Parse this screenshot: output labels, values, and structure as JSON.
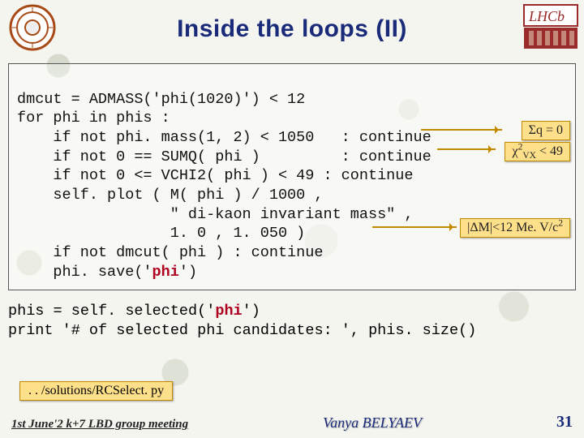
{
  "header": {
    "title": "Inside the loops (II)"
  },
  "code": {
    "l1": "dmcut = ADMASS('phi(1020)') < 12",
    "l2": "for phi in phis :",
    "l3": "    if not phi. mass(1, 2) < 1050   : continue",
    "l4": "    if not 0 == SUMQ( phi )         : continue",
    "l5": "    if not 0 <= VCHI2( phi ) < 49 : continue",
    "l6": "    self. plot ( M( phi ) / 1000 ,",
    "l7": "                 \" di-kaon invariant mass\" ,",
    "l8": "                 1. 0 , 1. 050 )",
    "l9": "    if not dmcut( phi ) : continue",
    "l10a": "    phi. save('",
    "l10b": "phi",
    "l10c": "')"
  },
  "callouts": {
    "c1": "Σq = 0",
    "c3_a": "|ΔM|<12 Me. V/c",
    "c3_sup": "2"
  },
  "lower": {
    "l1a": "phis = self. selected('",
    "l1b": "phi",
    "l1c": "')",
    "l2": "print '# of selected phi candidates: ', phis. size()"
  },
  "pathbox": ". . /solutions/RCSelect. py",
  "footer": {
    "left": "1st June'2 k+7  LBD group meeting",
    "center": "Vanya  BELYAEV",
    "pageno": "31"
  }
}
